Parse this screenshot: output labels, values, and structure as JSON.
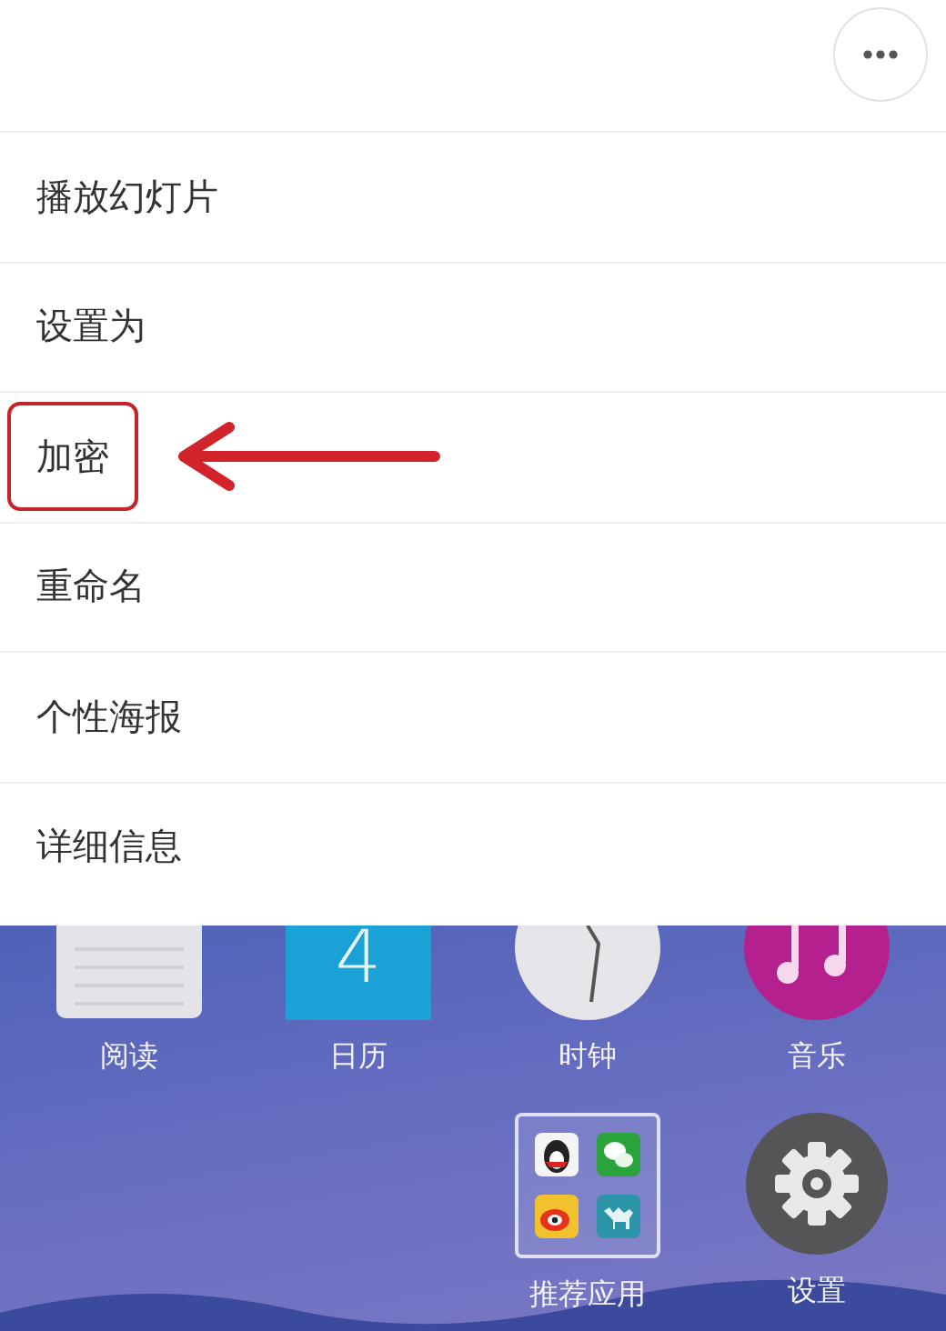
{
  "menu": {
    "items": [
      {
        "label": "播放幻灯片",
        "highlighted": false
      },
      {
        "label": "设置为",
        "highlighted": false
      },
      {
        "label": "加密",
        "highlighted": true
      },
      {
        "label": "重命名",
        "highlighted": false
      },
      {
        "label": "个性海报",
        "highlighted": false
      },
      {
        "label": "详细信息",
        "highlighted": false
      }
    ]
  },
  "home_screen": {
    "rows": [
      [
        {
          "label": "阅读",
          "kind": "notes"
        },
        {
          "label": "日历",
          "kind": "calendar",
          "day": "4"
        },
        {
          "label": "时钟",
          "kind": "clock"
        },
        {
          "label": "音乐",
          "kind": "music"
        }
      ],
      [
        "",
        "",
        {
          "label": "推荐应用",
          "kind": "folder"
        },
        {
          "label": "设置",
          "kind": "settings"
        }
      ]
    ]
  }
}
